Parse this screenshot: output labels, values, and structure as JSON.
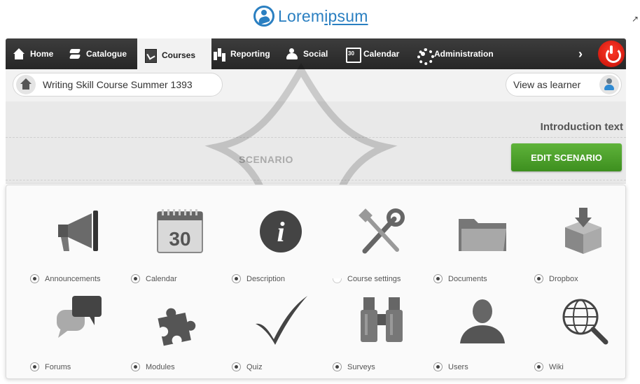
{
  "brand": {
    "name_part1": "Lorem",
    "name_part2": "ipsum",
    "color": "#2a7fc1"
  },
  "nav": {
    "items": [
      {
        "label": "Home",
        "icon": "home-icon"
      },
      {
        "label": "Catalogue",
        "icon": "layers-icon"
      },
      {
        "label": "Courses",
        "icon": "document-icon",
        "active": true
      },
      {
        "label": "Reporting",
        "icon": "bar-chart-icon"
      },
      {
        "label": "Social",
        "icon": "people-icon"
      },
      {
        "label": "Calendar",
        "icon": "calendar-icon"
      },
      {
        "label": "Administration",
        "icon": "gear-icon"
      }
    ],
    "next_glyph": "›",
    "logout_color": "#e0190c"
  },
  "course": {
    "title": "Writing Skill Course Summer 1393",
    "view_as_learner": "View as learner"
  },
  "intro": {
    "title": "Introduction text",
    "scenario_label": "SCENARIO",
    "edit_button": "EDIT SCENARIO",
    "edit_button_color": "#4aa02c"
  },
  "tools": [
    {
      "label": "Announcements",
      "icon": "megaphone-icon",
      "visible": true
    },
    {
      "label": "Calendar",
      "icon": "calendar-icon",
      "visible": true,
      "icon_text": "30"
    },
    {
      "label": "Description",
      "icon": "info-icon",
      "visible": true,
      "icon_text": "i"
    },
    {
      "label": "Course settings",
      "icon": "tools-icon",
      "visible": false
    },
    {
      "label": "Documents",
      "icon": "folder-icon",
      "visible": true
    },
    {
      "label": "Dropbox",
      "icon": "dropbox-icon",
      "visible": true
    },
    {
      "label": "Forums",
      "icon": "chat-bubbles-icon",
      "visible": true
    },
    {
      "label": "Modules",
      "icon": "puzzle-icon",
      "visible": true
    },
    {
      "label": "Quiz",
      "icon": "checkmark-icon",
      "visible": true
    },
    {
      "label": "Surveys",
      "icon": "binoculars-icon",
      "visible": true
    },
    {
      "label": "Users",
      "icon": "user-icon",
      "visible": true
    },
    {
      "label": "Wiki",
      "icon": "globe-search-icon",
      "visible": true
    }
  ]
}
